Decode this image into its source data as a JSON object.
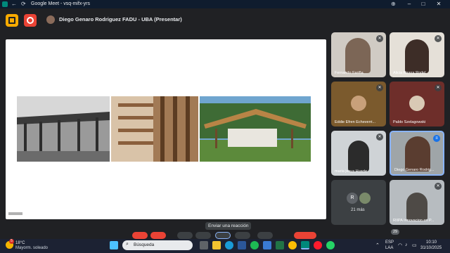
{
  "browser": {
    "title": "Google Meet - vsq-mifx-yrs"
  },
  "meeting": {
    "presenting_label": "Diego Genaro Rodriguez FADU - UBA (Presentar)",
    "reaction_tooltip": "Enviar una reacción"
  },
  "participants": [
    {
      "name": "Fernando Fariña",
      "muted": true
    },
    {
      "name": "Alicia Rivera Rodel",
      "muted": true
    },
    {
      "name": "Eddie Efren Echeverri...",
      "muted": true
    },
    {
      "name": "Pablo Szelagowski",
      "muted": true
    },
    {
      "name": "maria jesus Huarte",
      "muted": true
    },
    {
      "name": "Diego Genaro Rodrig...",
      "muted": false
    },
    {
      "name": "21 más",
      "initial": "R"
    },
    {
      "name": "RIIPA Innovacion en P...",
      "muted": true
    }
  ],
  "badge_count": "29",
  "taskbar": {
    "weather_temp": "18°C",
    "weather_desc": "Mayorm. soleado",
    "weather_badge": "5",
    "search_placeholder": "Búsqueda",
    "lang_code": "ESP",
    "lang_layout": "LAA",
    "time": "10:10",
    "date": "31/10/2025"
  },
  "colors": {
    "meet_background": "#202124",
    "leave_red": "#ea4335",
    "active_blue": "#8ab4f8",
    "taskbar": "#1c2233"
  }
}
